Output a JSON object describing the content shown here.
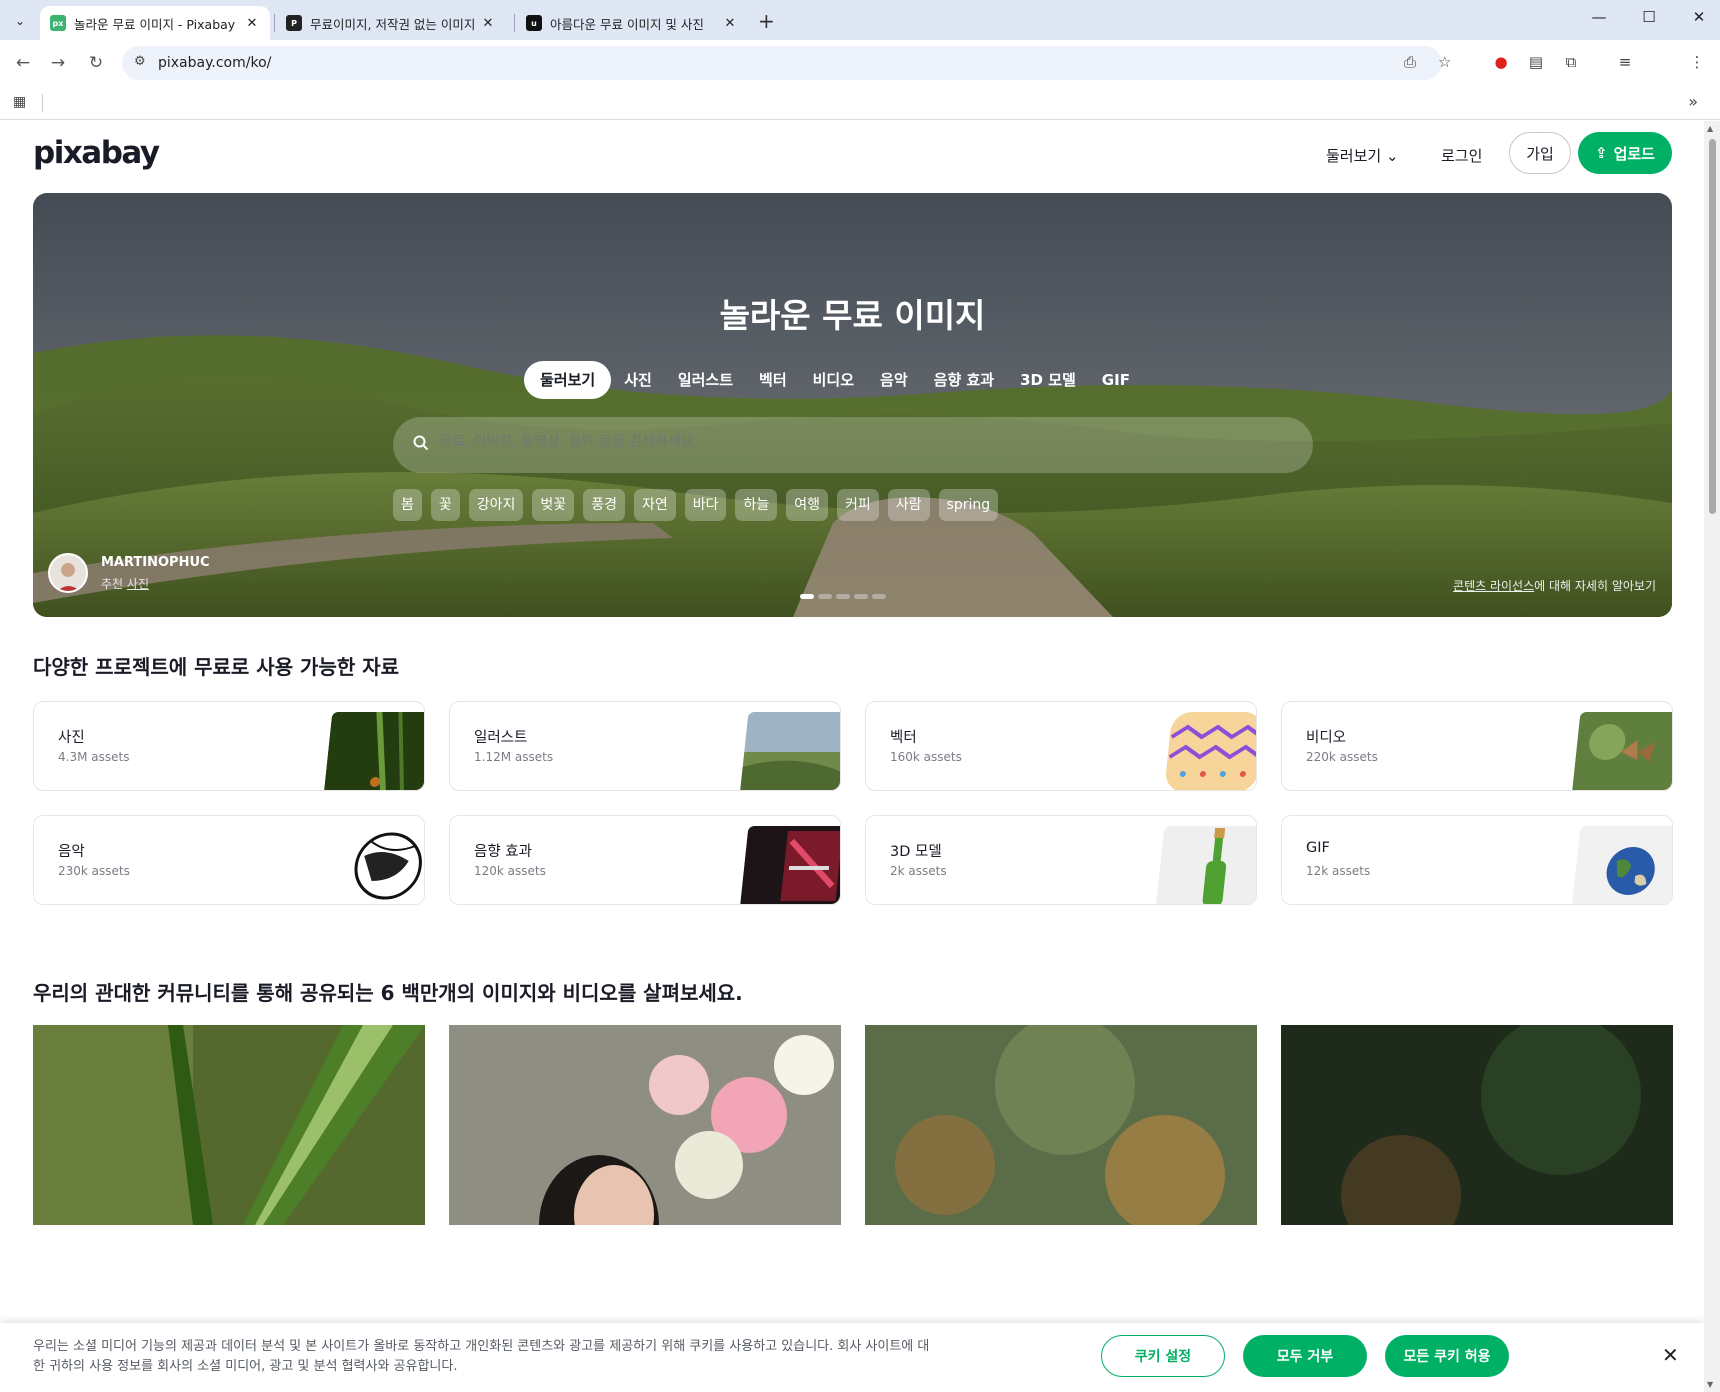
{
  "browser": {
    "tabs": [
      {
        "title": "놀라운 무료 이미지 - Pixabay",
        "favicon": "px",
        "active": true
      },
      {
        "title": "무료이미지, 저작권 없는 이미지",
        "favicon": "P",
        "active": false
      },
      {
        "title": "아름다운 무료 이미지 및 사진",
        "favicon": "u",
        "active": false
      }
    ],
    "url": "pixabay.com/ko/"
  },
  "header": {
    "logo": "pixabay",
    "explore": "둘러보기",
    "login": "로그인",
    "join": "가입",
    "upload": "업로드"
  },
  "hero": {
    "title": "놀라운 무료 이미지",
    "categories": [
      "둘러보기",
      "사진",
      "일러스트",
      "벡터",
      "비디오",
      "음악",
      "음향 효과",
      "3D 모델",
      "GIF"
    ],
    "search_placeholder": "무료, 이미지, 동영상, 음악 등을 검색하세요",
    "tags": [
      "봄",
      "꽃",
      "강아지",
      "벚꽃",
      "풍경",
      "자연",
      "바다",
      "하늘",
      "여행",
      "커피",
      "사람",
      "spring"
    ],
    "author": "MARTINOPHUC",
    "author_sub_prefix": "추천 ",
    "author_sub_link": "사진",
    "license_link": "콘텐츠 라이선스",
    "license_suffix": "에 대해 자세히 알아보기"
  },
  "assets_section": {
    "title": "다양한 프로젝트에 무료로 사용 가능한 자료",
    "cards": [
      {
        "name": "사진",
        "count": "4.3M assets"
      },
      {
        "name": "일러스트",
        "count": "1.12M assets"
      },
      {
        "name": "벡터",
        "count": "160k assets"
      },
      {
        "name": "비디오",
        "count": "220k assets"
      },
      {
        "name": "음악",
        "count": "230k assets"
      },
      {
        "name": "음향 효과",
        "count": "120k assets"
      },
      {
        "name": "3D 모델",
        "count": "2k assets"
      },
      {
        "name": "GIF",
        "count": "12k assets"
      }
    ]
  },
  "community_section": {
    "title": "우리의 관대한 커뮤니티를 통해 공유되는 6 백만개의 이미지와 비디오를 살펴보세요."
  },
  "cookie": {
    "text": "우리는 소셜 미디어 기능의 제공과 데이터 분석 및 본 사이트가 올바로 동작하고 개인화된 콘텐츠와 광고를 제공하기 위해 쿠키를 사용하고 있습니다. 회사 사이트에 대한 귀하의 사용 정보를 회사의 소셜 미디어, 광고 및 분석 협력사와 공유합니다.",
    "settings": "쿠키 설정",
    "reject": "모두 거부",
    "accept": "모든 쿠키 허용"
  },
  "colors": {
    "brand_green": "#00b064",
    "text_dark": "#191b26"
  }
}
